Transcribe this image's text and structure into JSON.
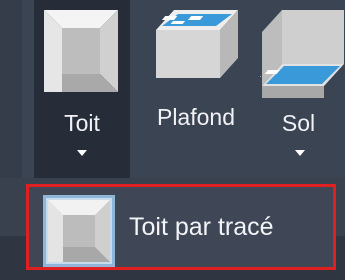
{
  "ribbon": {
    "buttons": [
      {
        "label": "Toit",
        "icon": "roof-icon",
        "has_dropdown": true,
        "active": true
      },
      {
        "label": "Plafond",
        "icon": "ceiling-icon",
        "has_dropdown": false,
        "active": false
      },
      {
        "label": "Sol",
        "icon": "floor-icon",
        "has_dropdown": true,
        "active": false
      }
    ]
  },
  "dropdown": {
    "items": [
      {
        "label": "Toit par tracé",
        "icon": "roof-by-footprint-icon",
        "highlighted": true
      }
    ]
  },
  "colors": {
    "panel_bg": "#3b4453",
    "active_bg": "#262d38",
    "highlight_border": "#e02020",
    "text": "#f0f2f5",
    "accent_blue": "#3a9ad9"
  }
}
